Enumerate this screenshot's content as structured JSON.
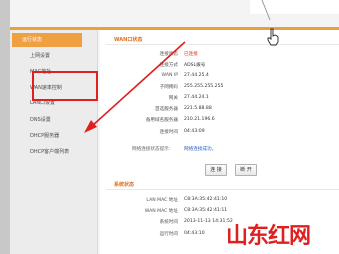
{
  "sidebar": {
    "items": [
      {
        "label": "运行状态",
        "active": true
      },
      {
        "label": "上网设置",
        "active": false
      },
      {
        "label": "MAC地址",
        "active": false
      },
      {
        "label": "WAN速率控制",
        "active": false
      },
      {
        "label": "LAN口设置",
        "active": false
      },
      {
        "label": "DNS设置",
        "active": false
      },
      {
        "label": "DHCP服务器",
        "active": false
      },
      {
        "label": "DHCP客户端列表",
        "active": false
      }
    ]
  },
  "wan": {
    "title": "WAN口状态",
    "rows": [
      {
        "label": "连接状态",
        "value": "已连接"
      },
      {
        "label": "连接方式",
        "value": "ADSL拨号"
      },
      {
        "label": "WAN IP",
        "value": "27.44.25.4"
      },
      {
        "label": "子网掩码",
        "value": "255.255.255.255"
      },
      {
        "label": "网关",
        "value": "27.44.24.1"
      },
      {
        "label": "首选服务器",
        "value": "221.5.88.88"
      },
      {
        "label": "备用域名服务器",
        "value": "210.21.196.6"
      },
      {
        "label": "连接时间",
        "value": "04:43:09"
      }
    ],
    "help_text": "网络连接状态提示:",
    "help_link": "网络连接成功。",
    "connect_button": "连 接",
    "disconnect_button": "断 开"
  },
  "system": {
    "title": "系统状态",
    "rows": [
      {
        "label": "LAN MAC 地址",
        "value": "C8:3A:35:42:41:10"
      },
      {
        "label": "WAN MAC 地址",
        "value": "C8:3A:35:42:41:11"
      },
      {
        "label": "系统时间",
        "value": "2013-11-13 14:31:52"
      },
      {
        "label": "运行时间",
        "value": "04:43:10"
      }
    ]
  },
  "watermark": "山东红网",
  "colors": {
    "accent": "#f0a040",
    "annotation": "#e02020"
  },
  "icons": {
    "pointer": "hand-pointer-icon",
    "arrow": "annotation-arrow"
  }
}
